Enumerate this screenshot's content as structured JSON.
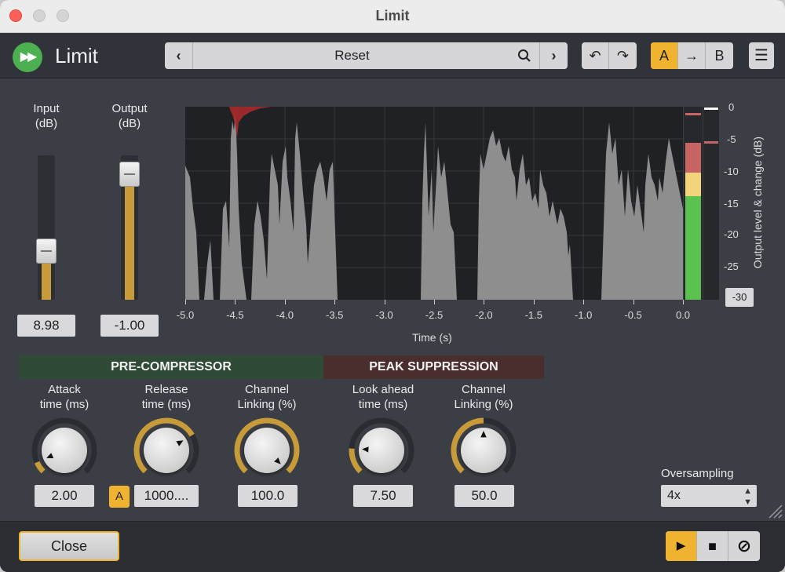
{
  "window": {
    "title": "Limit"
  },
  "header": {
    "plugin_name": "Limit",
    "preset": {
      "prev": "‹",
      "name": "Reset",
      "next": "›"
    },
    "undo": "↶",
    "redo": "↷",
    "ab": {
      "a": "A",
      "arrow": "→",
      "b": "B"
    },
    "menu": "☰"
  },
  "io": {
    "input": {
      "label_line1": "Input",
      "label_line2": "(dB)",
      "value": "8.98",
      "level": 0.3
    },
    "output": {
      "label_line1": "Output",
      "label_line2": "(dB)",
      "value": "-1.00",
      "level": 0.95
    }
  },
  "graph": {
    "x_ticks": [
      "-5.0",
      "-4.5",
      "-4.0",
      "-3.5",
      "-3.0",
      "-2.5",
      "-2.0",
      "-1.5",
      "-1.0",
      "-0.5",
      "0.0"
    ],
    "x_label": "Time (s)",
    "y_ticks": [
      "0",
      "-5",
      "-10",
      "-15",
      "-20",
      "-25"
    ],
    "y_min_button": "-30",
    "y_label": "Output level & change (dB)",
    "colors": {
      "waveform": "#8e8e8e",
      "reduction": "#b02a2a",
      "meter_green": "#5bc24f",
      "meter_yellow": "#f2d57a",
      "meter_red": "#c76464"
    }
  },
  "sections": {
    "pre_compressor": {
      "title": "PRE-COMPRESSOR",
      "color": "#2f4a35"
    },
    "peak_suppression": {
      "title": "PEAK SUPPRESSION",
      "color": "#4a2e2e"
    }
  },
  "knobs": {
    "attack": {
      "line1": "Attack",
      "line2": "time (ms)",
      "value": "2.00",
      "fraction": 0.08
    },
    "release": {
      "line1": "Release",
      "line2": "time (ms)",
      "value": "1000....",
      "fraction": 0.72,
      "auto_label": "A"
    },
    "pre_linking": {
      "line1": "Channel",
      "line2": "Linking (%)",
      "value": "100.0",
      "fraction": 1.0
    },
    "lookahead": {
      "line1": "Look ahead",
      "line2": "time (ms)",
      "value": "7.50",
      "fraction": 0.18
    },
    "peak_linking": {
      "line1": "Channel",
      "line2": "Linking (%)",
      "value": "50.0",
      "fraction": 0.5
    }
  },
  "oversampling": {
    "label": "Oversampling",
    "value": "4x"
  },
  "footer": {
    "close_label": "Close",
    "play": "▶",
    "stop": "■",
    "bypass": "⊘"
  }
}
